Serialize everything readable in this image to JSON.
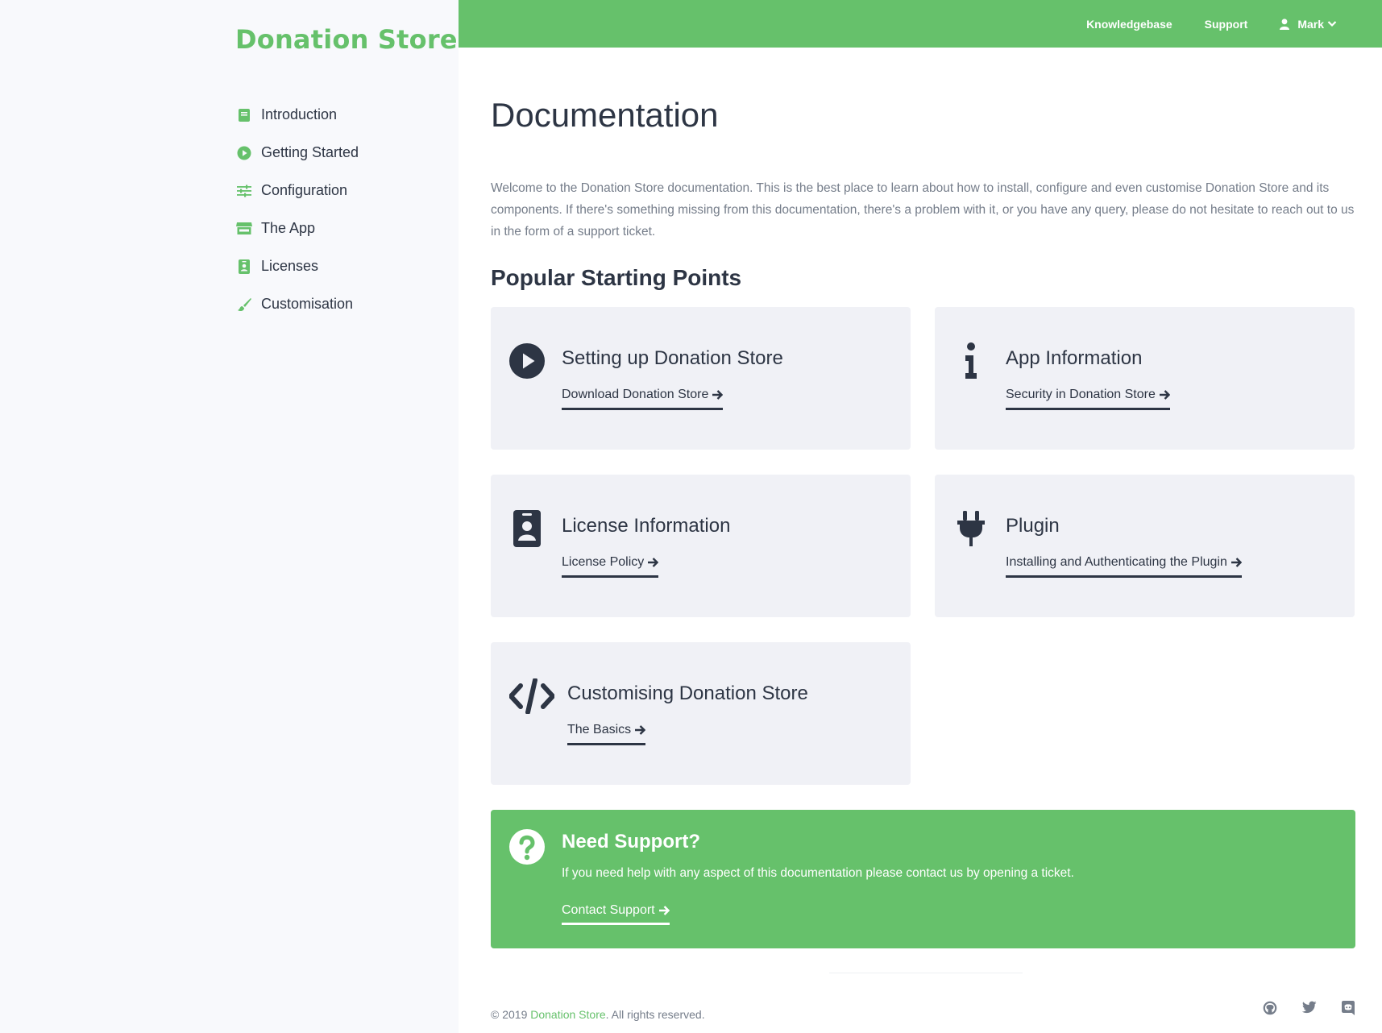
{
  "brand": "Donation Store",
  "sidebar": {
    "items": [
      {
        "label": "Introduction",
        "icon": "book-icon"
      },
      {
        "label": "Getting Started",
        "icon": "play-circle-icon"
      },
      {
        "label": "Configuration",
        "icon": "sliders-icon"
      },
      {
        "label": "The App",
        "icon": "store-icon"
      },
      {
        "label": "Licenses",
        "icon": "id-badge-icon"
      },
      {
        "label": "Customisation",
        "icon": "paint-brush-icon"
      }
    ]
  },
  "topbar": {
    "links": [
      "Knowledgebase",
      "Support"
    ],
    "user": "Mark"
  },
  "main": {
    "title": "Documentation",
    "intro": "Welcome to the Donation Store documentation. This is the best place to learn about how to install, configure and even customise Donation Store and its components. If there's something missing from this documentation, there's a problem with it, or you have any query, please do not hesitate to reach out to us in the form of a support ticket.",
    "section_title": "Popular Starting Points",
    "cards": [
      {
        "title": "Setting up Donation Store",
        "link": "Download Donation Store",
        "icon": "play-circle-icon"
      },
      {
        "title": "App Information",
        "link": "Security in Donation Store",
        "icon": "info-icon"
      },
      {
        "title": "License Information",
        "link": "License Policy",
        "icon": "id-badge-icon"
      },
      {
        "title": "Plugin",
        "link": "Installing and Authenticating the Plugin",
        "icon": "plug-icon"
      },
      {
        "title": "Customising Donation Store",
        "link": "The Basics",
        "icon": "code-icon"
      }
    ],
    "support": {
      "title": "Need Support?",
      "text": "If you need help with any aspect of this documentation please contact us by opening a ticket.",
      "link": "Contact Support"
    }
  },
  "footer": {
    "prefix": "© 2019 ",
    "brand": "Donation Store",
    "suffix": ". All rights reserved."
  },
  "colors": {
    "accent": "#66c16b",
    "text": "#2d3544",
    "muted": "#757d8a",
    "card_bg": "#f0f1f6",
    "sidebar_bg": "#f8f9fc"
  }
}
